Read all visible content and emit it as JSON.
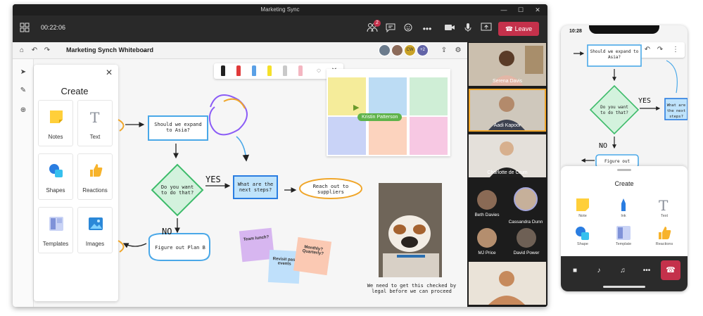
{
  "window": {
    "title": "Marketing Sync",
    "timer": "00:22:06",
    "leave_label": "Leave",
    "participants_badge": "2"
  },
  "whiteboard": {
    "title": "Marketing Synch Whiteboard",
    "avatar_initials": "CW",
    "avatar_overflow": "+2"
  },
  "create_panel": {
    "title": "Create",
    "tiles": [
      {
        "label": "Notes",
        "icon": "sticky-note-icon"
      },
      {
        "label": "Text",
        "icon": "text-icon"
      },
      {
        "label": "Shapes",
        "icon": "shapes-icon"
      },
      {
        "label": "Reactions",
        "icon": "thumbs-up-icon"
      },
      {
        "label": "Templates",
        "icon": "template-icon"
      },
      {
        "label": "Images",
        "icon": "image-icon"
      }
    ]
  },
  "pens": [
    {
      "color": "#222222"
    },
    {
      "color": "#e03a3a"
    },
    {
      "color": "#5aa0e6"
    },
    {
      "color": "#f5e02a"
    },
    {
      "color": "#c9c9c9"
    },
    {
      "color": "#f4b6c1"
    }
  ],
  "flowchart": {
    "q1": "Should we expand to Asia?",
    "q2": "Do you want to do that?",
    "yes": "YES",
    "no": "NO",
    "next": "What are the next steps?",
    "reach": "Reach out to suppliers",
    "planb": "Figure out Plan B"
  },
  "cursor_label": "Kristin Patterson",
  "stickies": [
    "Team lunch?",
    "Revisit past events",
    "Monthly? Quarterly?"
  ],
  "caption": "We need to get this checked by legal before we can proceed",
  "gallery": {
    "tiles": [
      "Serena Davis",
      "Aadi Kapoor",
      "Charlotte de Crum"
    ],
    "round": [
      "Beth Davies",
      "Cassandra Dunn",
      "MJ Price",
      "David Power"
    ]
  },
  "phone": {
    "time": "10:28",
    "q1": "Should we expand to Asia?",
    "q2": "Do you want to do that?",
    "yes": "YES",
    "no": "NO",
    "next": "What are the next steps?",
    "planb": "Figure out",
    "sheet_title": "Create",
    "items": [
      "Note",
      "Ink",
      "Text",
      "Shape",
      "Template",
      "Reactions"
    ]
  },
  "colors": {
    "leave": "#c4314b",
    "flow_blue": "#4aa8e8",
    "flow_green": "#3dbb6a",
    "flow_orange": "#f0a62a"
  }
}
